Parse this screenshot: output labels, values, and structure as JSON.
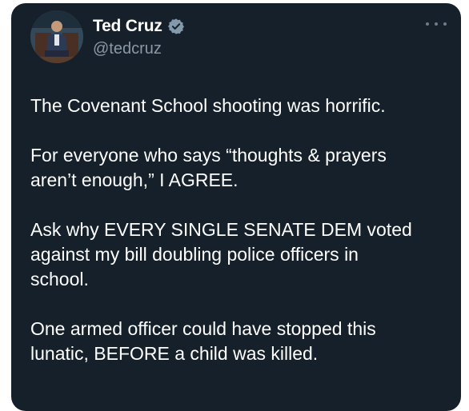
{
  "author": {
    "display_name": "Ted Cruz",
    "handle": "@tedcruz",
    "verified": true,
    "avatar_icon": "profile-photo"
  },
  "menu": {
    "icon": "more-options-icon"
  },
  "tweet": {
    "paragraphs": [
      "The Covenant School shooting was horrific.",
      "For everyone who says “thoughts & prayers\naren’t enough,” I AGREE.",
      "Ask why EVERY SINGLE SENATE DEM voted\nagainst my bill doubling police officers in\nschool.",
      "One armed officer could have stopped this\nlunatic, BEFORE a child was killed."
    ]
  },
  "colors": {
    "background": "#15202b",
    "text": "#ffffff",
    "secondary_text": "#8b98a5",
    "verified_badge": "#829aab"
  }
}
